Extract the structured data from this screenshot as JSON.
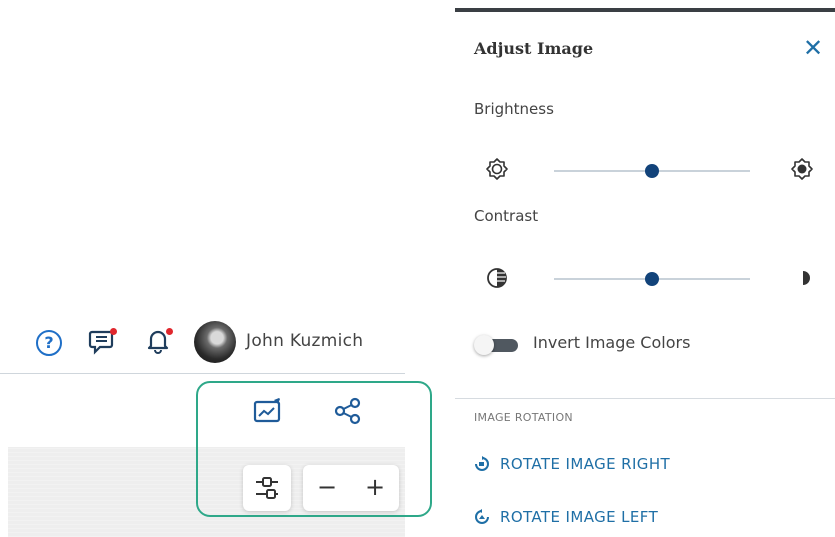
{
  "header": {
    "help_icon": "help-circle-icon",
    "comments_icon": "comments-icon",
    "notifications_icon": "bell-icon",
    "user_name": "John Kuzmich",
    "help_glyph": "?"
  },
  "toolbar": {
    "annotate_icon": "annotate-image-icon",
    "share_icon": "share-icon",
    "adjust_icon": "adjust-sliders-icon",
    "zoom_out_label": "−",
    "zoom_in_label": "+",
    "accent_color": "#2ea889"
  },
  "panel": {
    "title": "Adjust Image",
    "close_label": "✕",
    "brightness": {
      "label": "Brightness",
      "value": 50
    },
    "contrast": {
      "label": "Contrast",
      "value": 50
    },
    "invert": {
      "label": "Invert Image Colors",
      "enabled": false
    },
    "rotation": {
      "header": "IMAGE ROTATION",
      "right_label": "ROTATE IMAGE RIGHT",
      "left_label": "ROTATE IMAGE LEFT"
    },
    "accent_color": "#1f6fa6",
    "thumb_color": "#12437a"
  }
}
